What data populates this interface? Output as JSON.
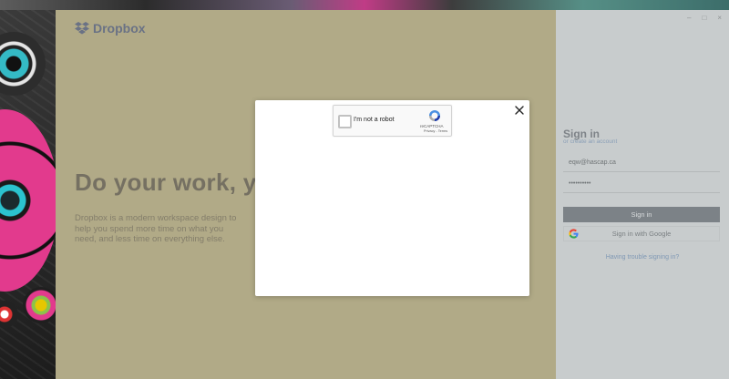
{
  "app": {
    "logo_text": "Dropbox",
    "hero_title": "Do your work, yo",
    "hero_subtitle": "Dropbox is a modern workspace design to help you spend more time on what you need, and less time on everything else.",
    "window_controls": [
      "–",
      "□",
      "×"
    ]
  },
  "signin": {
    "title": "Sign in",
    "create_account": "or create an account",
    "email_value": "eqw@hascap.ca",
    "password_value": "••••••••••",
    "signin_label": "Sign in",
    "google_label": "Sign in with Google",
    "trouble_link": "Having trouble signing in?"
  },
  "captcha": {
    "checkbox_label": "I'm not a robot",
    "brand": "reCAPTCHA",
    "terms": "Privacy - Terms",
    "checked": false
  },
  "colors": {
    "left_panel": "#b1aa87",
    "right_panel": "#c8cccd",
    "signin_button": "#7c8287",
    "link": "#7f98b4"
  }
}
